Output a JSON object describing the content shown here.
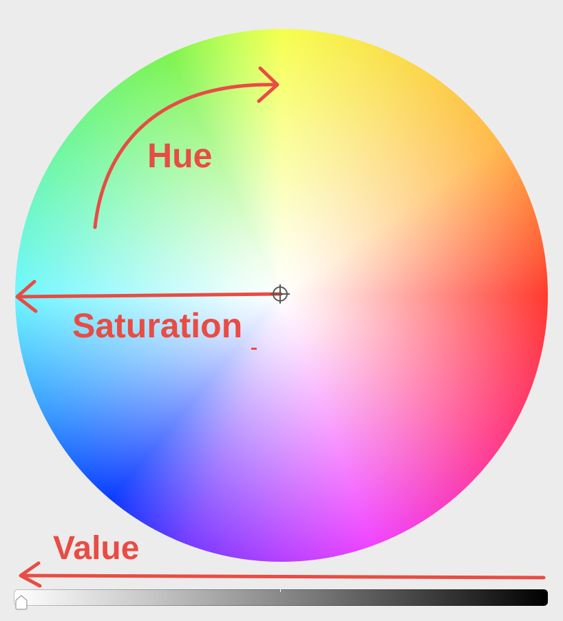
{
  "labels": {
    "hue": "Hue",
    "saturation": "Saturation",
    "value": "Value"
  },
  "colors": {
    "background": "#ececec",
    "annotation": "#e84c44",
    "crosshair": "#555555"
  },
  "color_wheel": {
    "hue_order_clockwise_from_top": [
      "yellow",
      "orange",
      "red",
      "pink",
      "magenta",
      "violet",
      "blue",
      "sky-blue",
      "cyan",
      "spring-green",
      "green",
      "yellow-green"
    ],
    "center_color": "#ffffff"
  },
  "value_slider": {
    "gradient": [
      "#ffffff",
      "#000000"
    ],
    "level": 0.0
  },
  "icons": {
    "crosshair": "crosshair-icon",
    "knob": "slider-knob-icon"
  }
}
